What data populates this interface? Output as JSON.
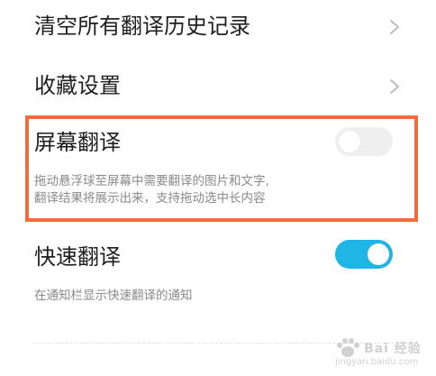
{
  "settings": {
    "clear_history": {
      "label": "清空所有翻译历史记录",
      "chevron_icon": "chevron-right-icon"
    },
    "favorites": {
      "label": "收藏设置",
      "chevron_icon": "chevron-right-icon"
    },
    "screen_translate": {
      "label": "屏幕翻译",
      "desc_line1": "拖动悬浮球至屏幕中需要翻译的图片和文字,",
      "desc_line2": "翻译结果将展示出来，支持拖动选中长内容",
      "enabled": false
    },
    "quick_translate": {
      "label": "快速翻译",
      "desc": "在通知栏显示快速翻译的通知",
      "enabled": true
    }
  },
  "colors": {
    "accent": "#1eb4e6",
    "highlight_border": "#f26b3a",
    "text_primary": "#1f1f1f",
    "text_secondary": "#8a8a8a"
  },
  "watermark": {
    "text": "Bai 经验",
    "sub": "jingyan.baidu.com"
  }
}
